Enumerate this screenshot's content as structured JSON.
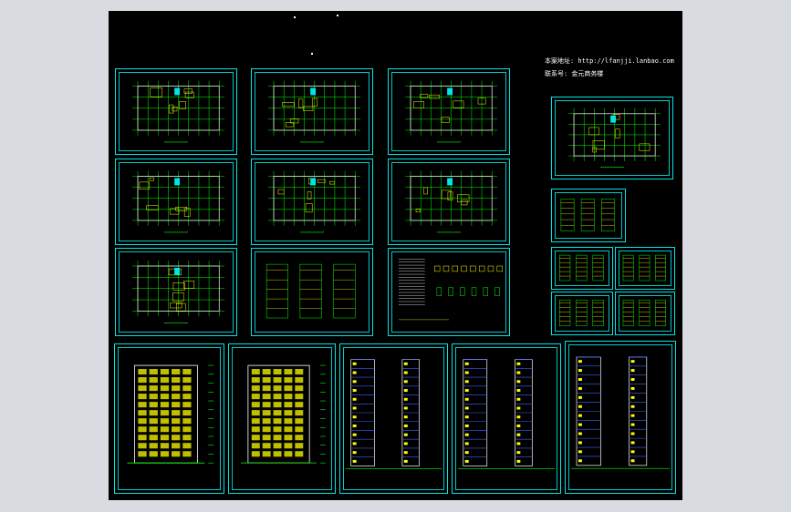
{
  "viewer": {
    "background": "#000000",
    "frame_color": "#00e5e5",
    "plan_color": "#00ff00",
    "accent_color": "#ffff00"
  },
  "notes": {
    "site_line": "本案地址: http://lfanjji.lanbao.com",
    "phone_line": "联系号: 金元商务楼"
  },
  "sheets": [
    {
      "id": "plan-1",
      "kind": "plan"
    },
    {
      "id": "plan-2",
      "kind": "plan"
    },
    {
      "id": "plan-3",
      "kind": "plan"
    },
    {
      "id": "plan-4",
      "kind": "plan"
    },
    {
      "id": "plan-5",
      "kind": "plan"
    },
    {
      "id": "plan-6",
      "kind": "plan"
    },
    {
      "id": "plan-7",
      "kind": "plan"
    },
    {
      "id": "plan-8",
      "kind": "detail"
    },
    {
      "id": "plan-9",
      "kind": "table"
    },
    {
      "id": "plan-10",
      "kind": "plan"
    },
    {
      "id": "detail-1",
      "kind": "detail"
    },
    {
      "id": "detail-2",
      "kind": "detail"
    },
    {
      "id": "detail-3",
      "kind": "detail"
    },
    {
      "id": "detail-4",
      "kind": "detail"
    },
    {
      "id": "detail-5",
      "kind": "detail"
    },
    {
      "id": "elevation-1",
      "kind": "elevation"
    },
    {
      "id": "elevation-2",
      "kind": "elevation"
    },
    {
      "id": "elevation-3",
      "kind": "section"
    },
    {
      "id": "elevation-4",
      "kind": "section"
    },
    {
      "id": "elevation-5",
      "kind": "section"
    }
  ]
}
